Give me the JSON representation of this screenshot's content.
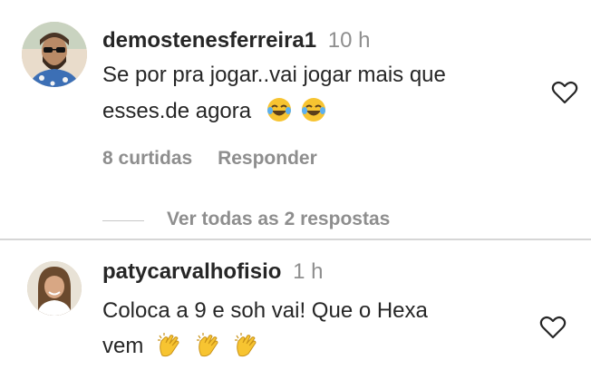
{
  "comments": [
    {
      "username": "demostenesferreira1",
      "time": "10 h",
      "text_line1": "Se por pra jogar..vai jogar mais que",
      "text_line2": "esses.de agora",
      "emojis": [
        "joy-emoji",
        "joy-emoji"
      ],
      "likes_label": "8 curtidas",
      "reply_label": "Responder",
      "view_replies_label": "Ver todas as 2 respostas"
    },
    {
      "username": "patycarvalhofisio",
      "time": "1 h",
      "text_line1": "Coloca a 9 e soh vai! Que o Hexa",
      "text_line2": "vem",
      "emojis": [
        "clapping-hands-emoji",
        "clapping-hands-emoji",
        "clapping-hands-emoji"
      ]
    }
  ],
  "colors": {
    "text": "#262626",
    "muted": "#8e8e8e",
    "divider": "#d6d6d6",
    "emoji_yellow": "#f7c431"
  }
}
